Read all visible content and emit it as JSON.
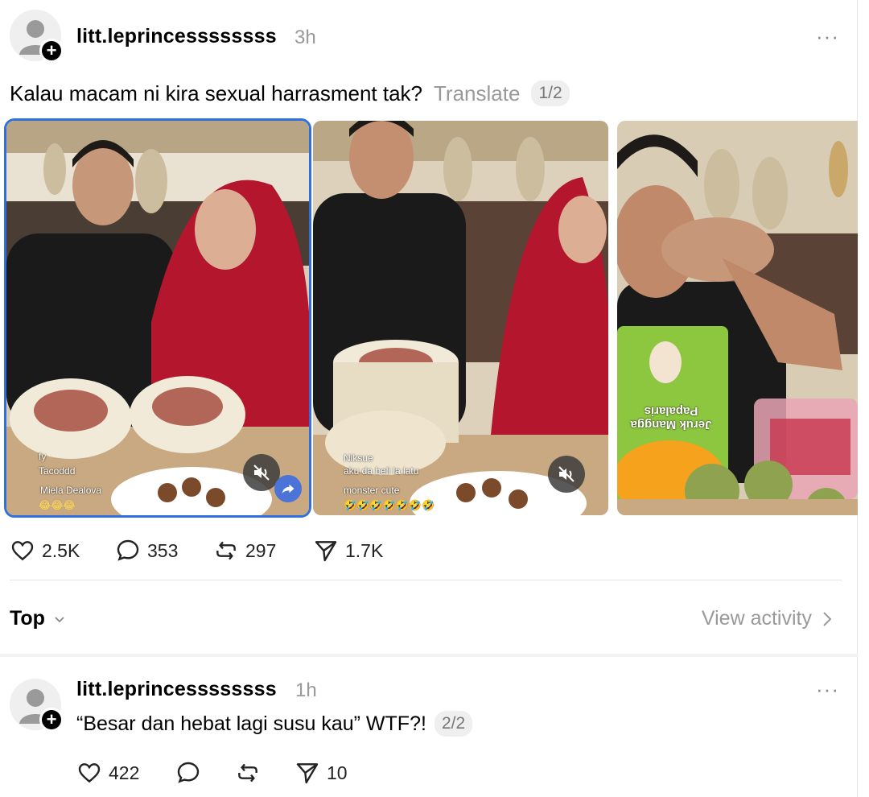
{
  "post": {
    "username": "litt.leprincessssssss",
    "time": "3h",
    "more": "···",
    "text": "Kalau macam ni kira sexual harrasment tak?",
    "translate": "Translate",
    "thread_position": "1/2",
    "media": [
      {
        "live_names": [
          "fy",
          "Tacoddd",
          "Miela Dealova"
        ],
        "emojis": "😂😂😂"
      },
      {
        "live_names": [
          "Niksue",
          "aku da beli la latu",
          "monster cute"
        ],
        "emojis": "🤣🤣🤣🤣🤣🤣🤣"
      },
      {
        "product_text": "Jeruk Mangga Papalaris"
      }
    ],
    "stats": {
      "likes": "2.5K",
      "comments": "353",
      "reposts": "297",
      "shares": "1.7K"
    }
  },
  "replies_header": {
    "sort_label": "Top",
    "view_activity": "View activity"
  },
  "reply": {
    "username": "litt.leprincessssssss",
    "time": "1h",
    "more": "···",
    "text": "“Besar dan hebat lagi susu kau” WTF?!",
    "thread_position": "2/2",
    "stats": {
      "likes": "422",
      "shares": "10"
    }
  },
  "colors": {
    "selected_outline": "#2f6fe0",
    "muted_text": "#999999"
  }
}
